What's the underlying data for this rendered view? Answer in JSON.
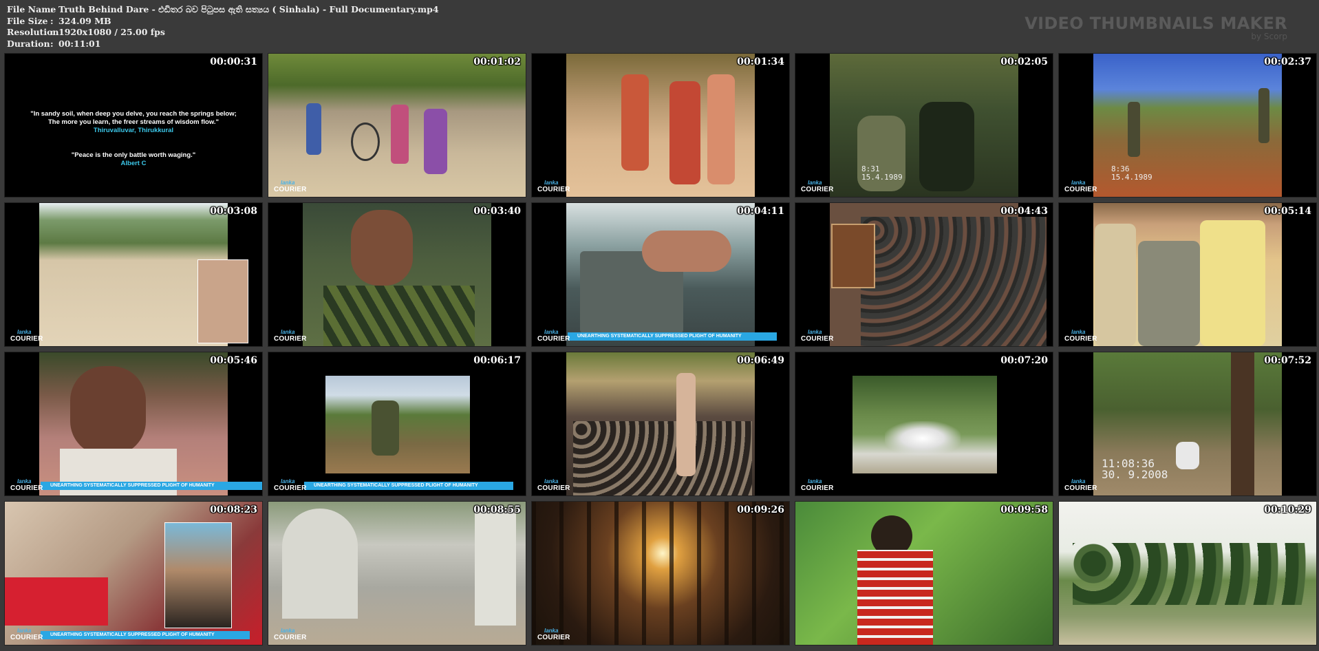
{
  "header": {
    "file_name_label": "File Name",
    "file_name": "Truth Behind Dare - එඩිතර බව පිටුපස ඇති සත්‍යය  ( Sinhala) - Full Documentary.mp4",
    "file_size_label": "File Size",
    "file_size": "324.09 MB",
    "resolution_label": "Resolution",
    "resolution": "1920x1080 / 25.00 fps",
    "duration_label": "Duration",
    "duration": "00:11:01",
    "separator": ":"
  },
  "brand": {
    "title": "VIDEO THUMBNAILS MAKER",
    "byline": "by Scorp"
  },
  "logo": {
    "line1": "lanka",
    "line2": "COURIER"
  },
  "banner_text": "UNEARTHING SYSTEMATICALLY SUPPRESSED PLIGHT OF HUMANITY",
  "quotes": {
    "q1_line1": "\"In sandy soil, when deep you delve, you reach the springs below;",
    "q1_line2": "The more you learn, the freer streams of wisdom flow.\"",
    "q1_author": "Thiruvalluvar, Thirukkural",
    "q2_line1": "\"Peace is the only battle worth waging.\"",
    "q2_author": "Albert C"
  },
  "stamps": {
    "s4_a": "8:31",
    "s4_b": "15.4.1989",
    "s5_a": "8:36",
    "s5_b": "15.4.1989",
    "s15_a": "11:08:36",
    "s15_b": "30. 9.2008"
  },
  "thumbnails": [
    {
      "time": "00:00:31"
    },
    {
      "time": "00:01:02"
    },
    {
      "time": "00:01:34"
    },
    {
      "time": "00:02:05"
    },
    {
      "time": "00:02:37"
    },
    {
      "time": "00:03:08"
    },
    {
      "time": "00:03:40"
    },
    {
      "time": "00:04:11"
    },
    {
      "time": "00:04:43"
    },
    {
      "time": "00:05:14"
    },
    {
      "time": "00:05:46"
    },
    {
      "time": "00:06:17"
    },
    {
      "time": "00:06:49"
    },
    {
      "time": "00:07:20"
    },
    {
      "time": "00:07:52"
    },
    {
      "time": "00:08:23"
    },
    {
      "time": "00:08:55"
    },
    {
      "time": "00:09:26"
    },
    {
      "time": "00:09:58"
    },
    {
      "time": "00:10:29"
    }
  ]
}
